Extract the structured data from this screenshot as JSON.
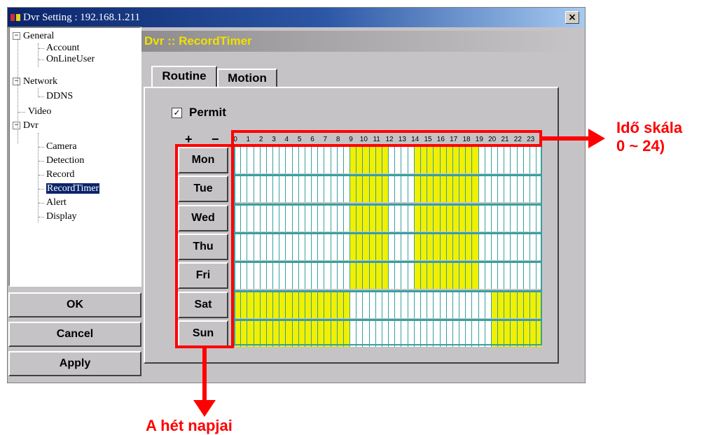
{
  "window": {
    "title": "Dvr Setting : 192.168.1.211",
    "close_label": "×"
  },
  "tree": [
    {
      "label": "General",
      "expander": "−"
    },
    {
      "label": "Account"
    },
    {
      "label": "OnLineUser"
    },
    {
      "label": "Network",
      "expander": "−"
    },
    {
      "label": "DDNS"
    },
    {
      "label": "Video"
    },
    {
      "label": "Dvr",
      "expander": "−"
    },
    {
      "label": "Camera"
    },
    {
      "label": "Detection"
    },
    {
      "label": "Record"
    },
    {
      "label": "RecordTimer",
      "selected": true
    },
    {
      "label": "Alert"
    },
    {
      "label": "Display"
    }
  ],
  "buttons": {
    "ok": "OK",
    "cancel": "Cancel",
    "apply": "Apply"
  },
  "header": {
    "title": "Dvr :: RecordTimer"
  },
  "tabs": [
    {
      "label": "Routine",
      "active": true
    },
    {
      "label": "Motion",
      "active": false
    }
  ],
  "permit": {
    "label": "Permit",
    "checked": true,
    "check_glyph": "✓"
  },
  "zoom": {
    "plus": "+",
    "minus": "−"
  },
  "hours": [
    "0",
    "1",
    "2",
    "3",
    "4",
    "5",
    "6",
    "7",
    "8",
    "9",
    "10",
    "11",
    "12",
    "13",
    "14",
    "15",
    "16",
    "17",
    "18",
    "19",
    "20",
    "21",
    "22",
    "23"
  ],
  "days": [
    "Mon",
    "Tue",
    "Wed",
    "Thu",
    "Fri",
    "Sat",
    "Sun"
  ],
  "schedule": {
    "Mon": [
      [
        9,
        11
      ],
      [
        14,
        18
      ]
    ],
    "Tue": [
      [
        9,
        11
      ],
      [
        14,
        18
      ]
    ],
    "Wed": [
      [
        9,
        11
      ],
      [
        14,
        18
      ]
    ],
    "Thu": [
      [
        9,
        11
      ],
      [
        14,
        18
      ]
    ],
    "Fri": [
      [
        9,
        11
      ],
      [
        14,
        18
      ]
    ],
    "Sat": [
      [
        0,
        8
      ],
      [
        20,
        23
      ]
    ],
    "Sun": [
      [
        0,
        8
      ],
      [
        20,
        23
      ]
    ]
  },
  "colors": {
    "recording": "#f0f000",
    "grid": "#38a0a0",
    "annotation": "#ff0000"
  },
  "annotations": {
    "time_scale_line1": "Idő skála",
    "time_scale_line2": "0 ~ 24)",
    "days_label": "A hét napjai"
  }
}
